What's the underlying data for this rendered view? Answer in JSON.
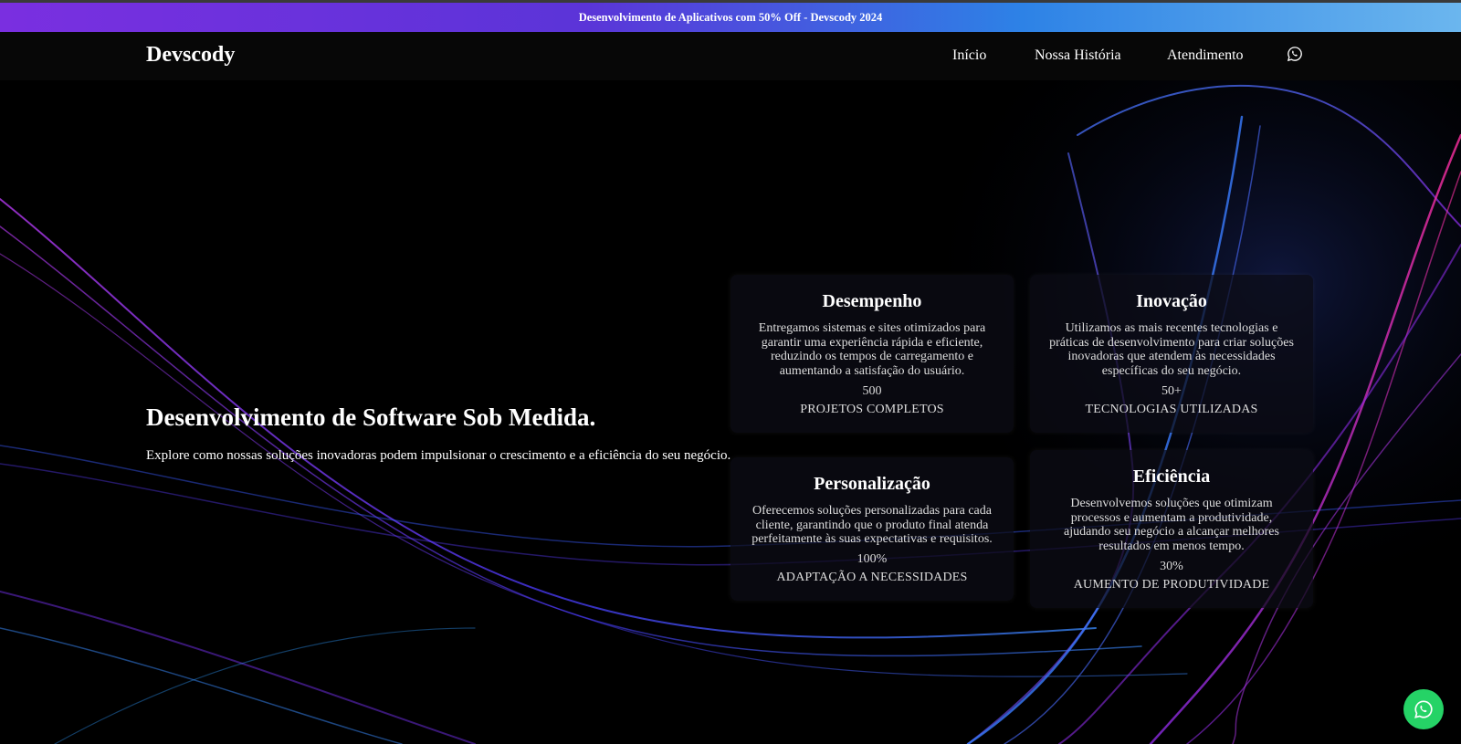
{
  "promo": {
    "text": "Desenvolvimento de Aplicativos com 50% Off - Devscody 2024"
  },
  "navbar": {
    "brand": "Devscody",
    "links": [
      {
        "label": "Início"
      },
      {
        "label": "Nossa História"
      },
      {
        "label": "Atendimento"
      }
    ],
    "whatsapp_icon": "whatsapp-icon"
  },
  "hero": {
    "title": "Desenvolvimento de Software Sob Medida.",
    "subtitle": "Explore como nossas soluções inovadoras podem impulsionar o crescimento e a eficiência do seu negócio."
  },
  "cards": [
    {
      "title": "Desempenho",
      "description": "Entregamos sistemas e sites otimizados para garantir uma experiência rápida e eficiente, reduzindo os tempos de carregamento e aumentando a satisfação do usuário.",
      "number": "500",
      "label": "PROJETOS COMPLETOS"
    },
    {
      "title": "Inovação",
      "description": "Utilizamos as mais recentes tecnologias e práticas de desenvolvimento para criar soluções inovadoras que atendem às necessidades específicas do seu negócio.",
      "number": "50+",
      "label": "TECNOLOGIAS UTILIZADAS"
    },
    {
      "title": "Personalização",
      "description": "Oferecemos soluções personalizadas para cada cliente, garantindo que o produto final atenda perfeitamente às suas expectativas e requisitos.",
      "number": "100%",
      "label": "ADAPTAÇÃO A NECESSIDADES"
    },
    {
      "title": "Eficiência",
      "description": "Desenvolvemos soluções que otimizam processos e aumentam a produtividade, ajudando seu negócio a alcançar melhores resultados em menos tempo.",
      "number": "30%",
      "label": "AUMENTO DE PRODUTIVIDADE"
    }
  ],
  "floating_button": {
    "icon": "whatsapp-icon"
  },
  "colors": {
    "promo_start": "#7a2fe0",
    "promo_end": "#6bb6ee",
    "whatsapp_green": "#25d366",
    "wave_blue": "#3a6cff",
    "wave_purple": "#8a2be2",
    "wave_pink": "#ff2fa0"
  }
}
